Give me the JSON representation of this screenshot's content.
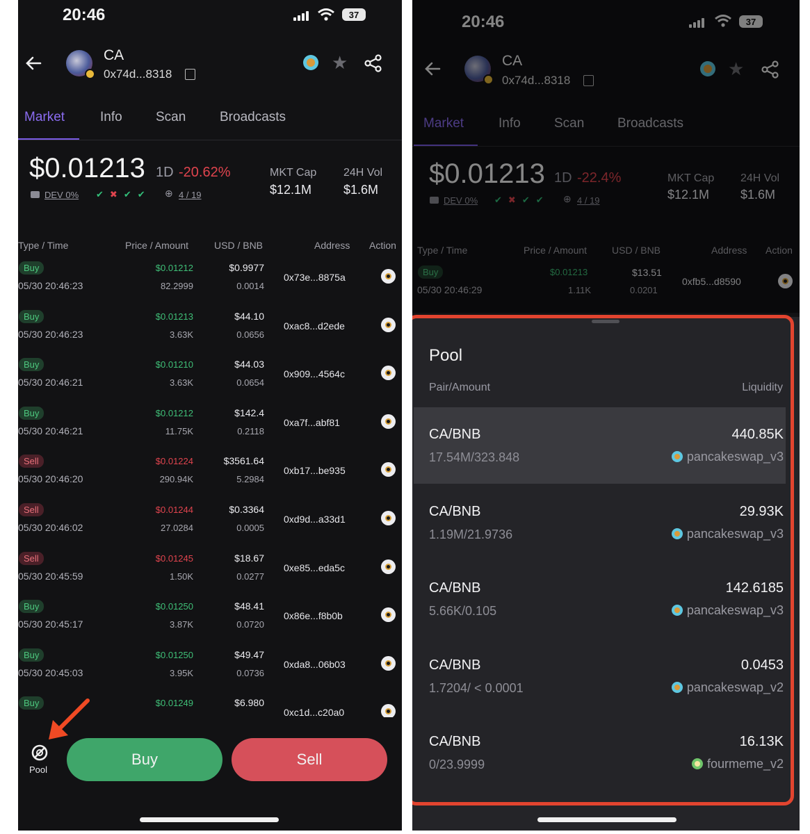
{
  "status": {
    "time": "20:46",
    "battery": "37"
  },
  "token": {
    "symbol": "CA",
    "address": "0x74d...8318"
  },
  "tabs": [
    {
      "label": "Market"
    },
    {
      "label": "Info"
    },
    {
      "label": "Scan"
    },
    {
      "label": "Broadcasts"
    }
  ],
  "market_left": {
    "price": "$0.01213",
    "period": "1D",
    "change": "-20.62%",
    "mkt_cap_label": "MKT Cap",
    "mkt_cap": "$12.1M",
    "vol_label": "24H Vol",
    "vol": "$1.6M",
    "dev": "DEV 0%",
    "holders": "4 / 19"
  },
  "market_right": {
    "price": "$0.01213",
    "period": "1D",
    "change": "-22.4%",
    "mkt_cap_label": "MKT Cap",
    "mkt_cap": "$12.1M",
    "vol_label": "24H Vol",
    "vol": "$1.6M",
    "dev": "DEV 0%",
    "holders": "4 / 19"
  },
  "table_headers": {
    "type_time": "Type / Time",
    "price_amount": "Price / Amount",
    "usd_bnb": "USD / BNB",
    "address": "Address",
    "action": "Action"
  },
  "trades": [
    {
      "type": "Buy",
      "time": "05/30 20:46:23",
      "price": "$0.01212",
      "amount": "82.2999",
      "usd": "$0.9977",
      "bnb": "0.0014",
      "address": "0x73e...8875a"
    },
    {
      "type": "Buy",
      "time": "05/30 20:46:23",
      "price": "$0.01213",
      "amount": "3.63K",
      "usd": "$44.10",
      "bnb": "0.0656",
      "address": "0xac8...d2ede"
    },
    {
      "type": "Buy",
      "time": "05/30 20:46:21",
      "price": "$0.01210",
      "amount": "3.63K",
      "usd": "$44.03",
      "bnb": "0.0654",
      "address": "0x909...4564c"
    },
    {
      "type": "Buy",
      "time": "05/30 20:46:21",
      "price": "$0.01212",
      "amount": "11.75K",
      "usd": "$142.4",
      "bnb": "0.2118",
      "address": "0xa7f...abf81"
    },
    {
      "type": "Sell",
      "time": "05/30 20:46:20",
      "price": "$0.01224",
      "amount": "290.94K",
      "usd": "$3561.64",
      "bnb": "5.2984",
      "address": "0xb17...be935"
    },
    {
      "type": "Sell",
      "time": "05/30 20:46:02",
      "price": "$0.01244",
      "amount": "27.0284",
      "usd": "$0.3364",
      "bnb": "0.0005",
      "address": "0xd9d...a33d1"
    },
    {
      "type": "Sell",
      "time": "05/30 20:45:59",
      "price": "$0.01245",
      "amount": "1.50K",
      "usd": "$18.67",
      "bnb": "0.0277",
      "address": "0xe85...eda5c"
    },
    {
      "type": "Buy",
      "time": "05/30 20:45:17",
      "price": "$0.01250",
      "amount": "3.87K",
      "usd": "$48.41",
      "bnb": "0.0720",
      "address": "0x86e...f8b0b"
    },
    {
      "type": "Buy",
      "time": "05/30 20:45:03",
      "price": "$0.01250",
      "amount": "3.95K",
      "usd": "$49.47",
      "bnb": "0.0736",
      "address": "0xda8...06b03"
    },
    {
      "type": "Buy",
      "time": "",
      "price": "$0.01249",
      "amount": "",
      "usd": "$6.980",
      "bnb": "",
      "address": "0xc1d...c20a0"
    }
  ],
  "right_trade": {
    "type": "Buy",
    "time": "05/30 20:46:29",
    "price": "$0.01213",
    "amount": "1.11K",
    "usd": "$13.51",
    "bnb": "0.0201",
    "address": "0xfb5...d8590"
  },
  "bottom": {
    "pool_label": "Pool",
    "buy_label": "Buy",
    "sell_label": "Sell"
  },
  "pool": {
    "title": "Pool",
    "pair_header": "Pair/Amount",
    "liquidity_header": "Liquidity",
    "rows": [
      {
        "pair": "CA/BNB",
        "amount": "17.54M/323.848",
        "liquidity": "440.85K",
        "dex": "pancakeswap_v3"
      },
      {
        "pair": "CA/BNB",
        "amount": "1.19M/21.9736",
        "liquidity": "29.93K",
        "dex": "pancakeswap_v3"
      },
      {
        "pair": "CA/BNB",
        "amount": "5.66K/0.105",
        "liquidity": "142.6185",
        "dex": "pancakeswap_v3"
      },
      {
        "pair": "CA/BNB",
        "amount": "1.7204/ < 0.0001",
        "liquidity": "0.0453",
        "dex": "pancakeswap_v2"
      },
      {
        "pair": "CA/BNB",
        "amount": "0/23.9999",
        "liquidity": "16.13K",
        "dex": "fourmeme_v2"
      }
    ]
  },
  "colors": {
    "accent": "#7b5ce6",
    "buy": "#3fbf77",
    "sell": "#e0444e",
    "highlight": "#e2442f",
    "arrow": "#f04a24"
  }
}
